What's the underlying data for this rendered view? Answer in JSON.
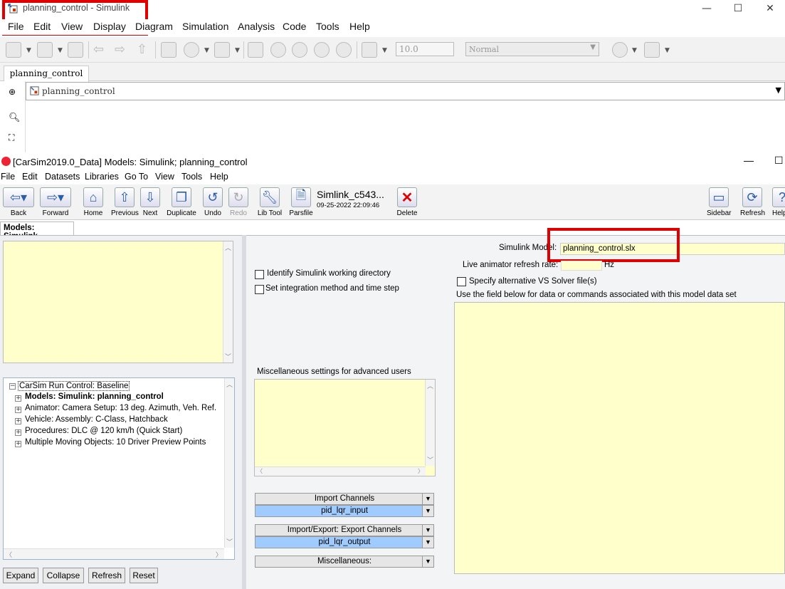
{
  "simulink": {
    "title": "planning_control - Simulink",
    "menu": [
      "File",
      "Edit",
      "View",
      "Display",
      "Diagram",
      "Simulation",
      "Analysis",
      "Code",
      "Tools",
      "Help"
    ],
    "stop_time": "10.0",
    "sim_mode": "Normal",
    "tab": "planning_control",
    "address": "planning_control"
  },
  "carsim": {
    "title": "[CarSim2019.0_Data] Models: Simulink; planning_control",
    "menu": [
      "File",
      "Edit",
      "Datasets",
      "Libraries",
      "Go To",
      "View",
      "Tools",
      "Help"
    ],
    "toolbar": {
      "back": "Back",
      "forward": "Forward",
      "home": "Home",
      "previous": "Previous",
      "next": "Next",
      "duplicate": "Duplicate",
      "undo": "Undo",
      "redo": "Redo",
      "lib_tool": "Lib Tool",
      "parsfile": "Parsfile",
      "dataset_name": "Simlink_c543...",
      "dataset_date": "09-25-2022 22:09:46",
      "delete": "Delete",
      "sidebar": "Sidebar",
      "refresh": "Refresh",
      "help": "Help"
    },
    "tab": "Models: Simulink",
    "tree": {
      "root": "CarSim Run Control: Baseline",
      "items": [
        "Models: Simulink: planning_control",
        "Animator: Camera Setup: 13 deg. Azimuth, Veh. Ref.",
        "Vehicle: Assembly: C-Class, Hatchback",
        "Procedures: DLC @ 120 km/h (Quick Start)",
        "Multiple Moving Objects: 10 Driver Preview Points"
      ]
    },
    "buttons": {
      "expand": "Expand",
      "collapse": "Collapse",
      "refresh": "Refresh",
      "reset": "Reset"
    },
    "checkboxes": {
      "identify": "Identify Simulink working directory",
      "integration": "Set integration method and time step",
      "alt_solver": "Specify alternative VS Solver file(s)"
    },
    "misc_label": "Miscellaneous settings for advanced users",
    "model_label": "Simulink Model:",
    "model_value": "planning_control.slx",
    "refresh_rate_label": "Live animator refresh rate:",
    "refresh_rate_value": "",
    "hz": "Hz",
    "field_label": "Use the field below  for data or commands associated with this model data set",
    "import_channels": "Import Channels",
    "import_value": "pid_lqr_input",
    "export_channels": "Import/Export: Export Channels",
    "export_value": "pid_lqr_output",
    "miscellaneous": "Miscellaneous:"
  }
}
